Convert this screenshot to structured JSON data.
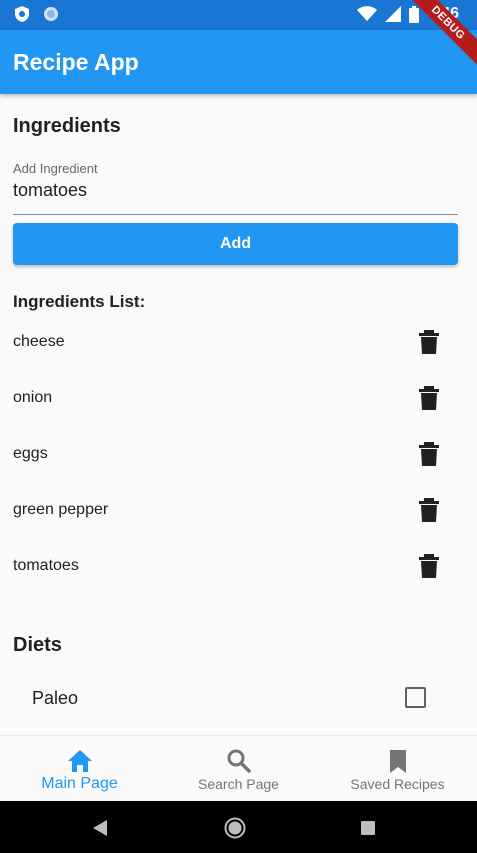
{
  "status_bar": {
    "time": "4:46"
  },
  "debug_banner": "DEBUG",
  "app_bar": {
    "title": "Recipe App"
  },
  "ingredients": {
    "title": "Ingredients",
    "input_label": "Add Ingredient",
    "input_value": "tomatoes",
    "add_button": "Add",
    "list_title": "Ingredients List:",
    "items": [
      "cheese",
      "onion",
      "eggs",
      "green pepper",
      "tomatoes"
    ]
  },
  "diets": {
    "title": "Diets",
    "items": [
      {
        "label": "Paleo",
        "checked": false
      }
    ]
  },
  "bottom_nav": {
    "items": [
      {
        "label": "Main Page",
        "icon": "home-icon",
        "active": true
      },
      {
        "label": "Search Page",
        "icon": "search-icon",
        "active": false
      },
      {
        "label": "Saved Recipes",
        "icon": "bookmark-icon",
        "active": false
      }
    ]
  },
  "colors": {
    "primary": "#2196f3",
    "status_bar": "#1976d2",
    "debug": "#b71c1c",
    "inactive": "#757575"
  }
}
